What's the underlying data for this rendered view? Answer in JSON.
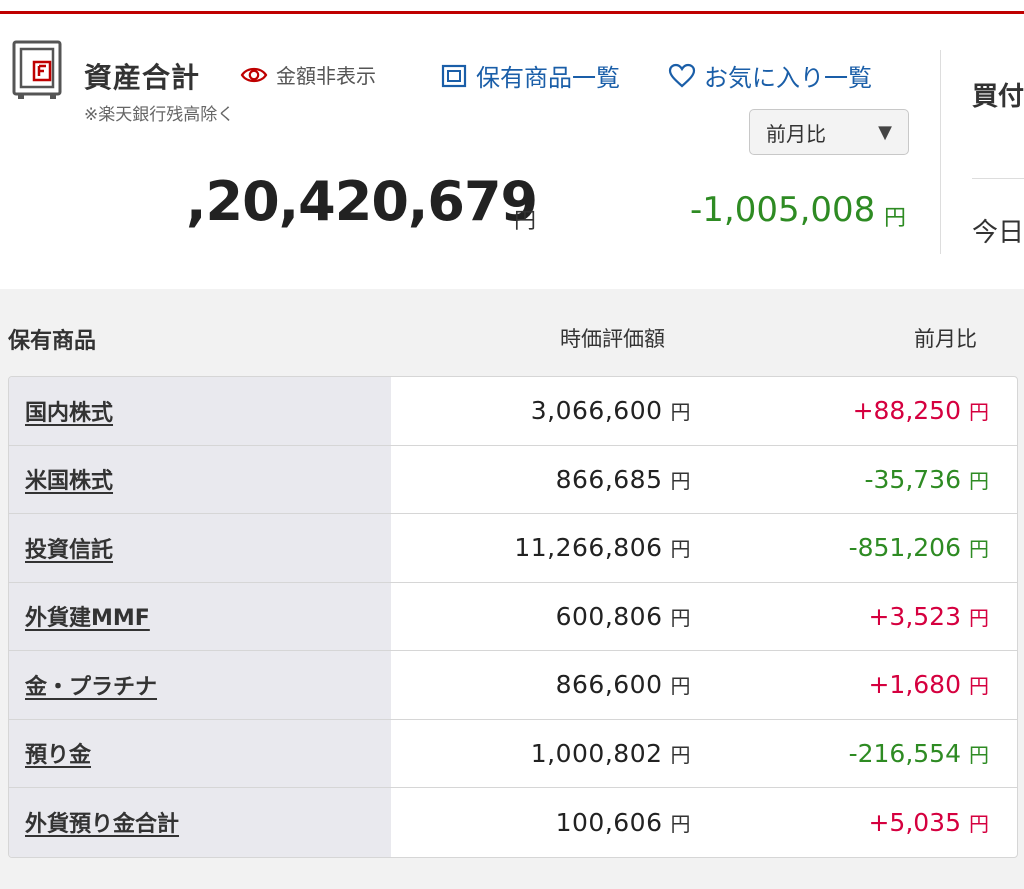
{
  "summary": {
    "title": "資産合計",
    "hide_amount_label": "金額非表示",
    "note": "※楽天銀行残高除く",
    "holdings_link": "保有商品一覧",
    "favorites_link": "お気に入り一覧",
    "period_selected": "前月比",
    "total_value": ",20,420,679",
    "total_unit": "円",
    "total_change": "-1,005,008",
    "total_change_unit": "円",
    "right_label_1": "買付",
    "right_label_2": "今日"
  },
  "holdings": {
    "header_name": "保有商品",
    "header_value": "時価評価額",
    "header_change": "前月比",
    "unit": "円",
    "rows": [
      {
        "name": "国内株式",
        "value": "3,066,600",
        "change": "+88,250",
        "sign": "pos"
      },
      {
        "name": "米国株式",
        "value": "866,685",
        "change": "-35,736",
        "sign": "neg"
      },
      {
        "name": "投資信託",
        "value": "11,266,806",
        "change": "-851,206",
        "sign": "neg"
      },
      {
        "name": "外貨建MMF",
        "value": "600,806",
        "change": "+3,523",
        "sign": "pos"
      },
      {
        "name": "金・プラチナ",
        "value": "866,600",
        "change": "+1,680",
        "sign": "pos"
      },
      {
        "name": "預り金",
        "value": "1,000,802",
        "change": "-216,554",
        "sign": "neg"
      },
      {
        "name": "外貨預り金合計",
        "value": "100,606",
        "change": "+5,035",
        "sign": "pos"
      }
    ]
  },
  "colors": {
    "brand": "#bf0000",
    "link": "#1a5ea8",
    "positive": "#d5003f",
    "negative": "#2e8b23"
  }
}
